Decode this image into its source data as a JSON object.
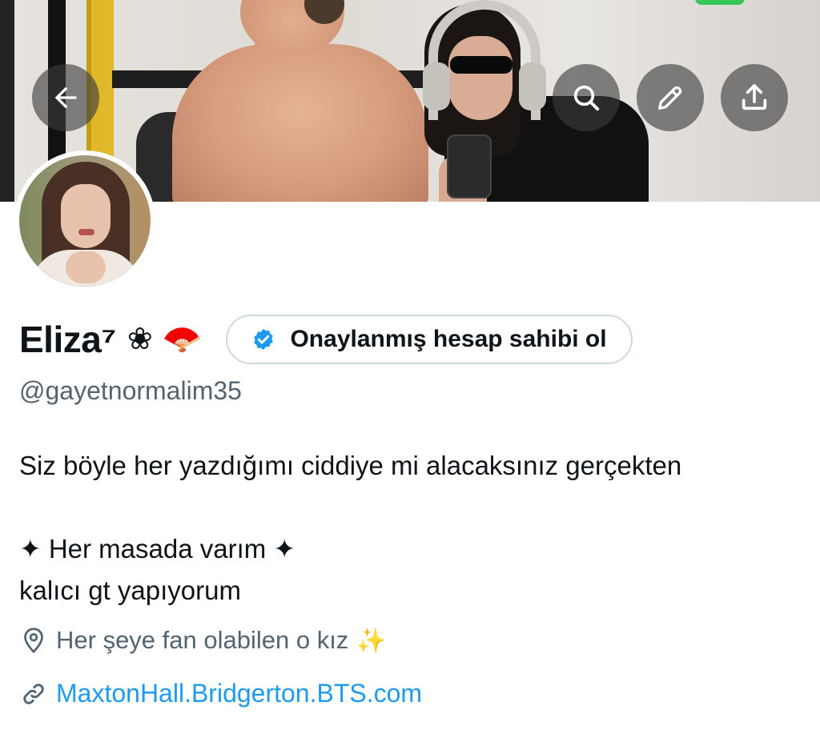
{
  "header": {
    "back_icon": "arrow-left-icon",
    "search_icon": "search-icon",
    "edit_icon": "pencil-icon",
    "share_icon": "share-upload-icon"
  },
  "profile": {
    "display_name": "Eliza⁷",
    "name_emoji_1": "❀",
    "name_emoji_2": "🪭",
    "verify_button_label": "Onaylanmış hesap sahibi ol",
    "verify_icon": "verified-badge-icon",
    "handle": "@gayetnormalim35",
    "bio": {
      "line1": "Siz böyle her yazdığımı ciddiye mi alacaksınız gerçekten",
      "line2": "✦ Her masada varım ✦",
      "line3": "kalıcı gt yapıyorum"
    },
    "location": {
      "icon": "location-pin-icon",
      "text": "Her şeye fan olabilen o kız",
      "emoji": "✨"
    },
    "website": {
      "icon": "link-icon",
      "text": "MaxtonHall.Bridgerton.BTS.com"
    }
  },
  "colors": {
    "link": "#1d9bf0",
    "secondary_text": "#536471",
    "verified_blue": "#1d9bf0",
    "border": "#cfd9de"
  }
}
